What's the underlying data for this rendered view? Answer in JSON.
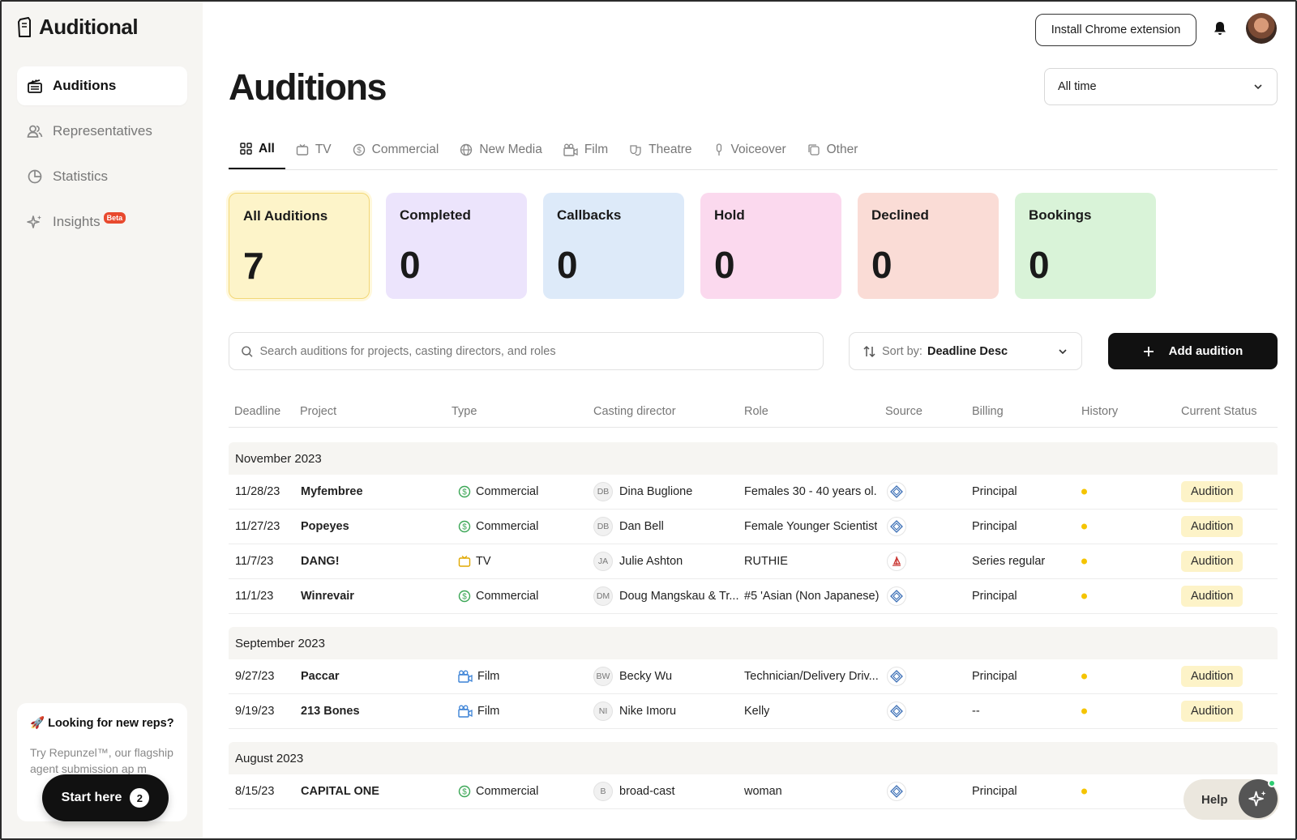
{
  "app": {
    "name": "Auditional"
  },
  "sidebar": {
    "items": [
      {
        "label": "Auditions",
        "icon": "clapperboard-icon"
      },
      {
        "label": "Representatives",
        "icon": "users-icon"
      },
      {
        "label": "Statistics",
        "icon": "pie-chart-icon"
      },
      {
        "label": "Insights",
        "icon": "sparkles-icon",
        "badge": "Beta"
      }
    ],
    "promo": {
      "title": "🚀 Looking for new reps?",
      "body": "Try Repunzel™, our flagship agent submission ap m"
    },
    "start_here": {
      "label": "Start here",
      "count": "2"
    }
  },
  "header": {
    "chrome_extension_label": "Install Chrome extension",
    "title": "Auditions",
    "time_filter": "All time"
  },
  "tabs": [
    {
      "label": "All",
      "icon": "grid-icon"
    },
    {
      "label": "TV",
      "icon": "tv-icon"
    },
    {
      "label": "Commercial",
      "icon": "dollar-icon"
    },
    {
      "label": "New Media",
      "icon": "globe-icon"
    },
    {
      "label": "Film",
      "icon": "film-camera-icon"
    },
    {
      "label": "Theatre",
      "icon": "masks-icon"
    },
    {
      "label": "Voiceover",
      "icon": "microphone-icon"
    },
    {
      "label": "Other",
      "icon": "copy-icon"
    }
  ],
  "stats": [
    {
      "label": "All Auditions",
      "value": "7",
      "color": "#fdf4c9"
    },
    {
      "label": "Completed",
      "value": "0",
      "color": "#ece4fc"
    },
    {
      "label": "Callbacks",
      "value": "0",
      "color": "#ddeaf9"
    },
    {
      "label": "Hold",
      "value": "0",
      "color": "#fbd9ee"
    },
    {
      "label": "Declined",
      "value": "0",
      "color": "#fadcd6"
    },
    {
      "label": "Bookings",
      "value": "0",
      "color": "#d9f3d8"
    }
  ],
  "toolbar": {
    "search_placeholder": "Search auditions for projects, casting directors, and roles",
    "sort_prefix": "Sort by:",
    "sort_value": "Deadline Desc",
    "add_label": "Add audition"
  },
  "table": {
    "headers": [
      "Deadline",
      "Project",
      "Type",
      "Casting director",
      "Role",
      "Source",
      "Billing",
      "History",
      "Current Status"
    ],
    "groups": [
      {
        "label": "November 2023",
        "rows": [
          {
            "deadline": "11/28/23",
            "project": "Myfembree",
            "type": "Commercial",
            "initials": "DB",
            "cd": "Dina Buglione",
            "role": "Females 30 - 40 years ol.",
            "billing": "Principal",
            "status": "Audition"
          },
          {
            "deadline": "11/27/23",
            "project": "Popeyes",
            "type": "Commercial",
            "initials": "DB",
            "cd": "Dan Bell",
            "role": "Female Younger Scientist",
            "billing": "Principal",
            "status": "Audition"
          },
          {
            "deadline": "11/7/23",
            "project": "DANG!",
            "type": "TV",
            "initials": "JA",
            "cd": "Julie Ashton",
            "role": "RUTHIE",
            "billing": "Series regular",
            "status": "Audition"
          },
          {
            "deadline": "11/1/23",
            "project": "Winrevair",
            "type": "Commercial",
            "initials": "DM",
            "cd": "Doug Mangskau & Tr...",
            "role": "#5 'Asian (Non Japanese)",
            "billing": "Principal",
            "status": "Audition"
          }
        ]
      },
      {
        "label": "September 2023",
        "rows": [
          {
            "deadline": "9/27/23",
            "project": "Paccar",
            "type": "Film",
            "initials": "BW",
            "cd": "Becky Wu",
            "role": "Technician/Delivery Driv...",
            "billing": "Principal",
            "status": "Audition"
          },
          {
            "deadline": "9/19/23",
            "project": "213 Bones",
            "type": "Film",
            "initials": "NI",
            "cd": "Nike Imoru",
            "role": "Kelly",
            "billing": "--",
            "status": "Audition"
          }
        ]
      },
      {
        "label": "August 2023",
        "rows": [
          {
            "deadline": "8/15/23",
            "project": "CAPITAL ONE",
            "type": "Commercial",
            "initials": "B",
            "cd": "broad-cast",
            "role": "woman",
            "billing": "Principal",
            "status": ""
          }
        ]
      }
    ]
  },
  "help": {
    "label": "Help"
  }
}
